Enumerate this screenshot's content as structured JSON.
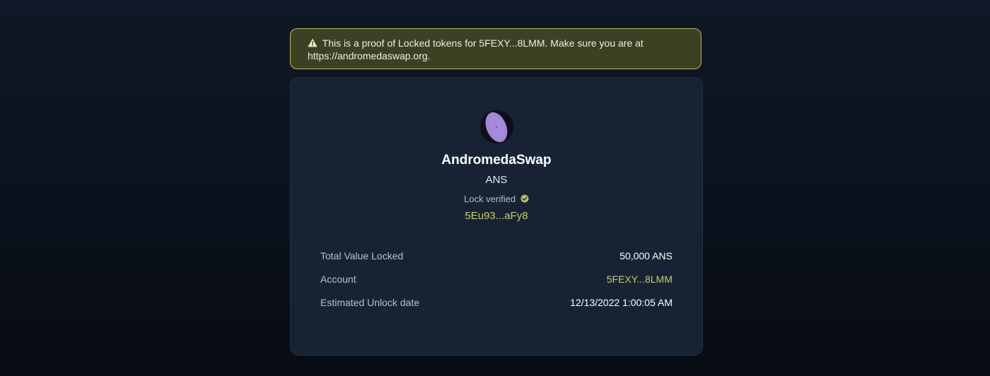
{
  "banner": {
    "icon": "warning-triangle-icon",
    "message": "This is a proof of Locked tokens for 5FEXY...8LMM. Make sure you are at",
    "url": "https://andromedaswap.org."
  },
  "token": {
    "avatar_icon": "andromeda-galaxy-logo-icon",
    "name": "AndromedaSwap",
    "symbol": "ANS",
    "lock_status": "Lock verified",
    "lock_status_icon": "check-circle-icon",
    "lock_address": "5Eu93...aFy8"
  },
  "details": {
    "rows": [
      {
        "label": "Total Value Locked",
        "value": "50,000 ANS"
      },
      {
        "label": "Account",
        "value": "5FEXY...8LMM"
      },
      {
        "label": "Estimated Unlock date",
        "value": "12/13/2022 1:00:05 AM"
      }
    ]
  },
  "colors": {
    "accent": "#c8cf63",
    "banner_background": "#3b4122",
    "banner_border": "#b6bb55",
    "card_background": "#172334",
    "page_background": "#0b121d"
  }
}
